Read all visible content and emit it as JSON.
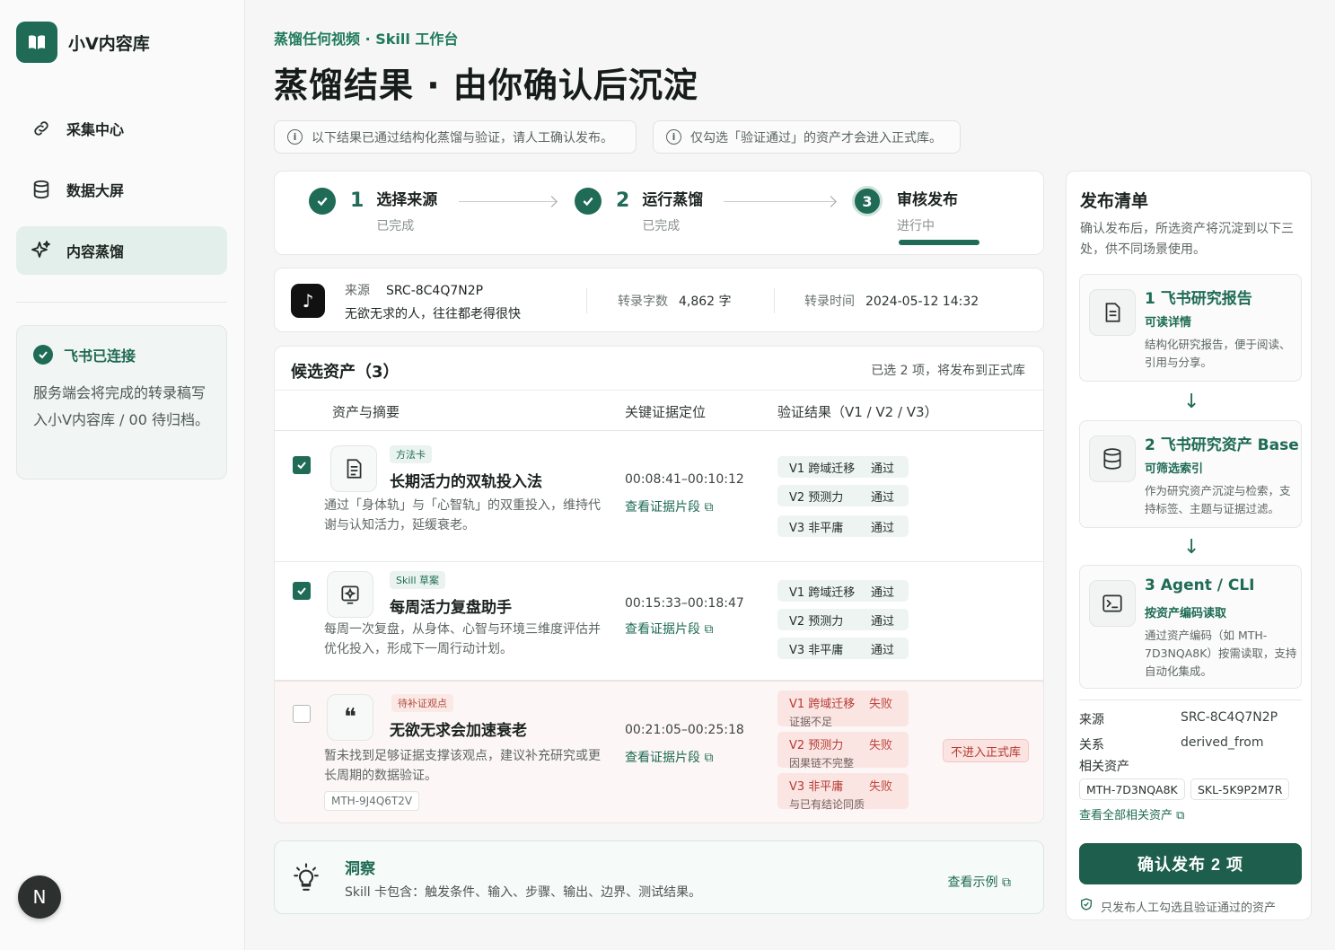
{
  "brand": {
    "name": "小V内容库"
  },
  "nav": [
    {
      "label": "采集中心",
      "icon": "link-icon"
    },
    {
      "label": "数据大屏",
      "icon": "database-icon"
    },
    {
      "label": "内容蒸馏",
      "icon": "sparkle-icon",
      "active": true
    }
  ],
  "connect": {
    "title": "飞书已连接",
    "desc": "服务端会将完成的转录稿写入小V内容库 / 00 待归档。"
  },
  "avatar": "N",
  "breadcrumb": "蒸馏任何视频 · Skill 工作台",
  "page_title": "蒸馏结果 · 由你确认后沉淀",
  "notices": [
    "以下结果已通过结构化蒸馏与验证，请人工确认发布。",
    "仅勾选「验证通过」的资产才会进入正式库。"
  ],
  "steps": [
    {
      "num": "1",
      "name": "选择来源",
      "status": "已完成"
    },
    {
      "num": "2",
      "name": "运行蒸馏",
      "status": "已完成"
    },
    {
      "num": "3",
      "name": "审核发布",
      "status": "进行中"
    }
  ],
  "source": {
    "label": "来源",
    "id": "SRC-8C4Q7N2P",
    "title": "无欲无求的人，往往都老得很快",
    "word_label": "转录字数",
    "word_value": "4,862 字",
    "time_label": "转录时间",
    "time_value": "2024-05-12 14:32"
  },
  "candidates": {
    "title": "候选资产（3）",
    "summary": "已选 2 项，将发布到正式库",
    "columns": [
      "资产与摘要",
      "关键证据定位",
      "验证结果（V1 / V2 / V3）"
    ],
    "evidence_link": "查看证据片段",
    "rows": [
      {
        "checked": true,
        "tag": "方法卡",
        "title": "长期活力的双轨投入法",
        "desc": "通过「身体轨」与「心智轨」的双重投入，维持代谢与认知活力，延缓衰老。",
        "time": "00:08:41–00:10:12",
        "checks": [
          {
            "name": "V1 跨域迁移",
            "result": "通过"
          },
          {
            "name": "V2 预测力",
            "result": "通过"
          },
          {
            "name": "V3 非平庸",
            "result": "通过"
          }
        ]
      },
      {
        "checked": true,
        "tag": "Skill 草案",
        "title": "每周活力复盘助手",
        "desc": "每周一次复盘，从身体、心智与环境三维度评估并优化投入，形成下一周行动计划。",
        "time": "00:15:33–00:18:47",
        "checks": [
          {
            "name": "V1 跨域迁移",
            "result": "通过"
          },
          {
            "name": "V2 预测力",
            "result": "通过"
          },
          {
            "name": "V3 非平庸",
            "result": "通过"
          }
        ]
      },
      {
        "checked": false,
        "tag": "待补证观点",
        "title": "无欲无求会加速衰老",
        "desc": "暂未找到足够证据支撑该观点，建议补充研究或更长周期的数据验证。",
        "code": "MTH-9J4Q6T2V",
        "time": "00:21:05–00:25:18",
        "reject": "不进入正式库",
        "checks": [
          {
            "name": "V1 跨域迁移",
            "result": "失败",
            "note": "证据不足"
          },
          {
            "name": "V2 预测力",
            "result": "失败",
            "note": "因果链不完整"
          },
          {
            "name": "V3 非平庸",
            "result": "失败",
            "note": "与已有结论同质"
          }
        ]
      }
    ]
  },
  "insight": {
    "title": "洞察",
    "desc": "Skill 卡包含：触发条件、输入、步骤、输出、边界、测试结果。",
    "link": "查看示例"
  },
  "publish": {
    "title": "发布清单",
    "desc": "确认发布后，所选资产将沉淀到以下三处，供不同场景使用。",
    "destinations": [
      {
        "title": "1 飞书研究报告",
        "sub": "可读详情",
        "desc": "结构化研究报告，便于阅读、引用与分享。"
      },
      {
        "title": "2 飞书研究资产 Base",
        "sub": "可筛选索引",
        "desc": "作为研究资产沉淀与检索，支持标签、主题与证据过滤。"
      },
      {
        "title": "3 Agent / CLI",
        "sub": "按资产编码读取",
        "desc": "通过资产编码（如 MTH-7D3NQA8K）按需读取，支持自动化集成。"
      }
    ],
    "meta": {
      "source_label": "来源",
      "source_value": "SRC-8C4Q7N2P",
      "relation_label": "关系",
      "relation_value": "derived_from",
      "related_label": "相关资产"
    },
    "related": [
      "MTH-7D3NQA8K",
      "SKL-5K9P2M7R"
    ],
    "view_all": "查看全部相关资产",
    "confirm": "确认发布 2 项",
    "footnote": "只发布人工勾选且验证通过的资产"
  }
}
